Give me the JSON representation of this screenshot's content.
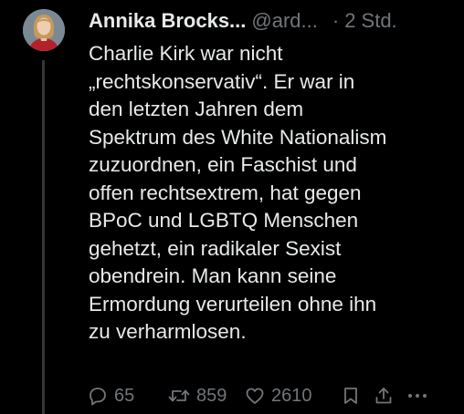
{
  "tweet": {
    "author_name": "Annika Brocks...",
    "handle": "@ard...",
    "separator": "·",
    "time": "2 Std.",
    "lines": [
      "Charlie Kirk war nicht",
      "„rechtskonservativ“. Er war in",
      "den letzten Jahren dem",
      "Spektrum des White Nationalism",
      "zuzuordnen, ein Faschist und",
      "offen rechtsextrem, hat gegen",
      "BPoC und LGBTQ Menschen",
      "gehetzt, ein radikaler Sexist",
      "obendrein. Man kann seine",
      "Ermordung verurteilen ohne ihn",
      "zu verharmlosen."
    ]
  },
  "actions": {
    "reply_count": "65",
    "retweet_count": "859",
    "like_count": "2610",
    "reply_icon": "speech-bubble-icon",
    "retweet_icon": "retweet-arrows-icon",
    "like_icon": "heart-icon",
    "bookmark_icon": "bookmark-icon",
    "share_icon": "share-upload-icon",
    "more_icon": "ellipsis-icon"
  },
  "colors": {
    "background": "#000000",
    "text_primary": "#e7e9ea",
    "text_secondary": "#71767b",
    "thread_line": "#333639"
  }
}
